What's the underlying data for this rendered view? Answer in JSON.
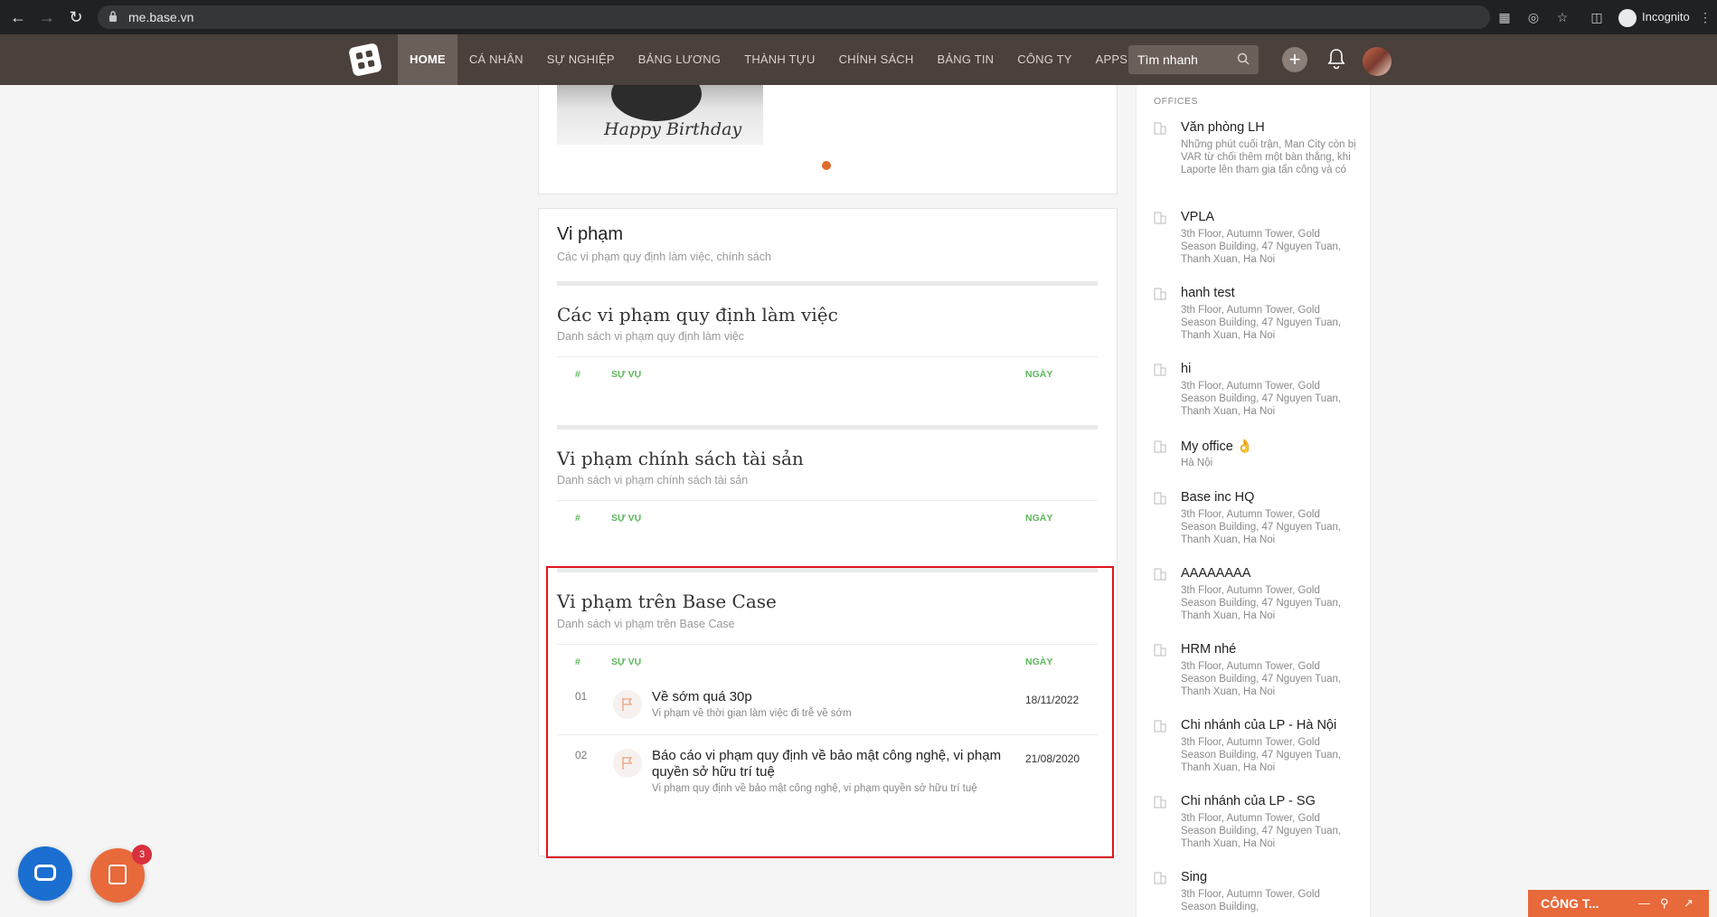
{
  "browser": {
    "url": "me.base.vn",
    "profile_label": "Incognito"
  },
  "nav": {
    "items": [
      "HOME",
      "CÁ NHÂN",
      "SỰ NGHIỆP",
      "BẢNG LƯƠNG",
      "THÀNH TỰU",
      "CHÍNH SÁCH",
      "BẢNG TIN",
      "CÔNG TY",
      "APPS"
    ],
    "active": "HOME",
    "search_placeholder": "Tìm nhanh",
    "plus": "+"
  },
  "birthday_image": {
    "caption": "Happy Birthday"
  },
  "violations": {
    "title": "Vi phạm",
    "subtitle": "Các vi phạm quy định làm việc, chính sách",
    "sections": [
      {
        "title": "Các vi phạm quy định làm việc",
        "subtitle": "Danh sách vi phạm quy định làm việc",
        "headers": {
          "num": "#",
          "case": "SỰ VỤ",
          "date": "NGÀY"
        },
        "rows": []
      },
      {
        "title": "Vi phạm chính sách tài sản",
        "subtitle": "Danh sách vi phạm chính sách tài sản",
        "headers": {
          "num": "#",
          "case": "SỰ VỤ",
          "date": "NGÀY"
        },
        "rows": []
      },
      {
        "title": "Vi phạm trên Base Case",
        "subtitle": "Danh sách vi phạm trên Base Case",
        "headers": {
          "num": "#",
          "case": "SỰ VỤ",
          "date": "NGÀY"
        },
        "rows": [
          {
            "num": "01",
            "title": "Về sớm quá 30p",
            "desc": "Vi phạm về thời gian làm việc đi trễ về sớm",
            "date": "18/11/2022"
          },
          {
            "num": "02",
            "title": "Báo cáo vi phạm quy định về bảo mật công nghệ, vi phạm quyền sở hữu trí tuệ",
            "desc": "Vi phạm quy định về bảo mật công nghệ, vi phạm quyền sở hữu trí tuệ",
            "date": "21/08/2020"
          }
        ]
      }
    ]
  },
  "offices": {
    "header": "OFFICES",
    "items": [
      {
        "name": "Văn phòng LH",
        "address": "Những phút cuối trận, Man City còn bị VAR từ chối thêm một bàn thắng, khi Laporte lên tham gia tấn công và có"
      },
      {
        "name": "VPLA",
        "address": "3th Floor, Autumn Tower, Gold Season Building, 47 Nguyen Tuan, Thanh Xuan, Ha Noi"
      },
      {
        "name": "hanh test",
        "address": "3th Floor, Autumn Tower, Gold Season Building, 47 Nguyen Tuan, Thanh Xuan, Ha Noi"
      },
      {
        "name": "hi",
        "address": "3th Floor, Autumn Tower, Gold Season Building, 47 Nguyen Tuan, Thanh Xuan, Ha Noi"
      },
      {
        "name": "My office 👌",
        "address": "Hà Nội"
      },
      {
        "name": "Base inc HQ",
        "address": "3th Floor, Autumn Tower, Gold Season Building, 47 Nguyen Tuan, Thanh Xuan, Ha Noi"
      },
      {
        "name": "AAAAAAAA",
        "address": "3th Floor, Autumn Tower, Gold Season Building, 47 Nguyen Tuan, Thanh Xuan, Ha Noi"
      },
      {
        "name": "HRM nhé",
        "address": "3th Floor, Autumn Tower, Gold Season Building, 47 Nguyen Tuan, Thanh Xuan, Ha Noi"
      },
      {
        "name": "Chi nhánh của LP - Hà Nội",
        "address": "3th Floor, Autumn Tower, Gold Season Building, 47 Nguyen Tuan, Thanh Xuan, Ha Noi"
      },
      {
        "name": "Chi nhánh của LP - SG",
        "address": "3th Floor, Autumn Tower, Gold Season Building, 47 Nguyen Tuan, Thanh Xuan, Ha Noi"
      },
      {
        "name": "Sing",
        "address": "3th Floor, Autumn Tower, Gold Season Building,"
      }
    ]
  },
  "floating": {
    "task_badge": "3",
    "company_panel_label": "CÔNG T..."
  },
  "colors": {
    "nav_bg": "#4a403c",
    "accent_orange": "#e8693a",
    "table_header_green": "#5cb85c",
    "highlight_red": "#e0161e",
    "chat_blue": "#1b6fd1"
  }
}
